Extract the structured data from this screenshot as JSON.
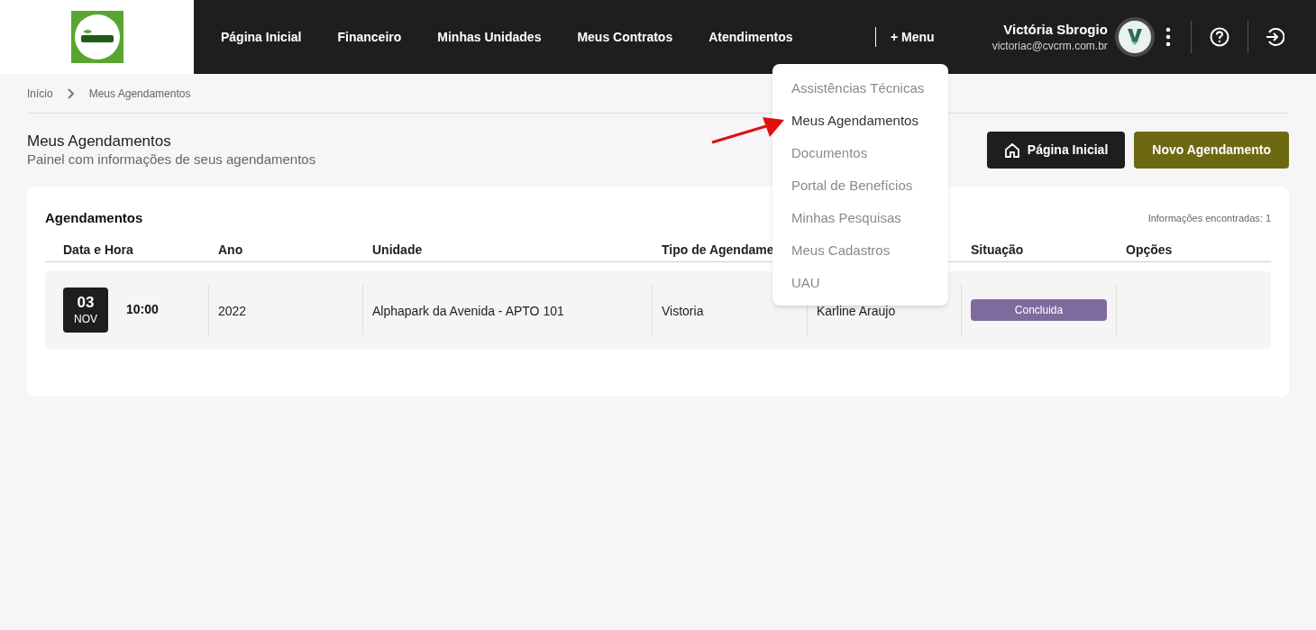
{
  "nav": {
    "items": [
      "Página Inicial",
      "Financeiro",
      "Minhas Unidades",
      "Meus Contratos",
      "Atendimentos"
    ],
    "menu_button": "+ Menu"
  },
  "user": {
    "name": "Victória Sbrogio",
    "email": "victoriac@cvcrm.com.br"
  },
  "dropdown": [
    {
      "label": "Assistências Técnicas",
      "selected": false
    },
    {
      "label": "Meus Agendamentos",
      "selected": true
    },
    {
      "label": "Documentos",
      "selected": false
    },
    {
      "label": "Portal de Benefícios",
      "selected": false
    },
    {
      "label": "Minhas Pesquisas",
      "selected": false
    },
    {
      "label": "Meus Cadastros",
      "selected": false
    },
    {
      "label": "UAU",
      "selected": false
    }
  ],
  "breadcrumb": [
    "Início",
    "Meus Agendamentos"
  ],
  "page": {
    "title": "Meus Agendamentos",
    "subtitle": "Painel com informações de seus agendamentos",
    "buttons": [
      "Página Inicial",
      "Novo Agendamento"
    ]
  },
  "table": {
    "title": "Agendamentos",
    "count": "Informações encontradas: 1",
    "columns": [
      "Data e Hora",
      "Ano",
      "Unidade",
      "Tipo de Agendame",
      "",
      "Situação",
      "Opções"
    ],
    "rows": [
      {
        "day": "03",
        "month": "NOV",
        "time": "10:00",
        "year": "2022",
        "unit": "Alphapark da Avenida - APTO 101",
        "type": "Vistoria",
        "column_5": "Karline Araujo",
        "status": "Concluida"
      }
    ]
  }
}
